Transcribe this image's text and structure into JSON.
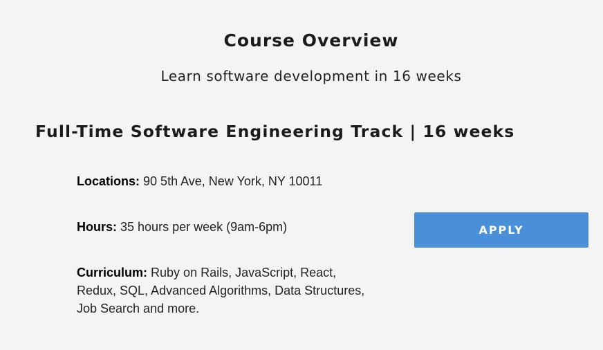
{
  "overview": {
    "title": "Course Overview",
    "subtitle": "Learn software development in 16 weeks"
  },
  "track": {
    "title": "Full-Time Software Engineering Track | 16 weeks"
  },
  "details": {
    "locations": {
      "label": "Locations:",
      "value": "90 5th Ave, New York, NY 10011"
    },
    "hours": {
      "label": "Hours:",
      "value": "35 hours per week (9am-6pm)"
    },
    "curriculum": {
      "label": "Curriculum:",
      "value": "Ruby on Rails, JavaScript, React, Redux, SQL, Advanced Algorithms, Data Structures, Job Search and more."
    }
  },
  "apply_button": {
    "label": "APPLY",
    "color": "#4a90d9"
  },
  "colors": {
    "background": "#f4f4f4",
    "text": "#1b1b1b"
  }
}
